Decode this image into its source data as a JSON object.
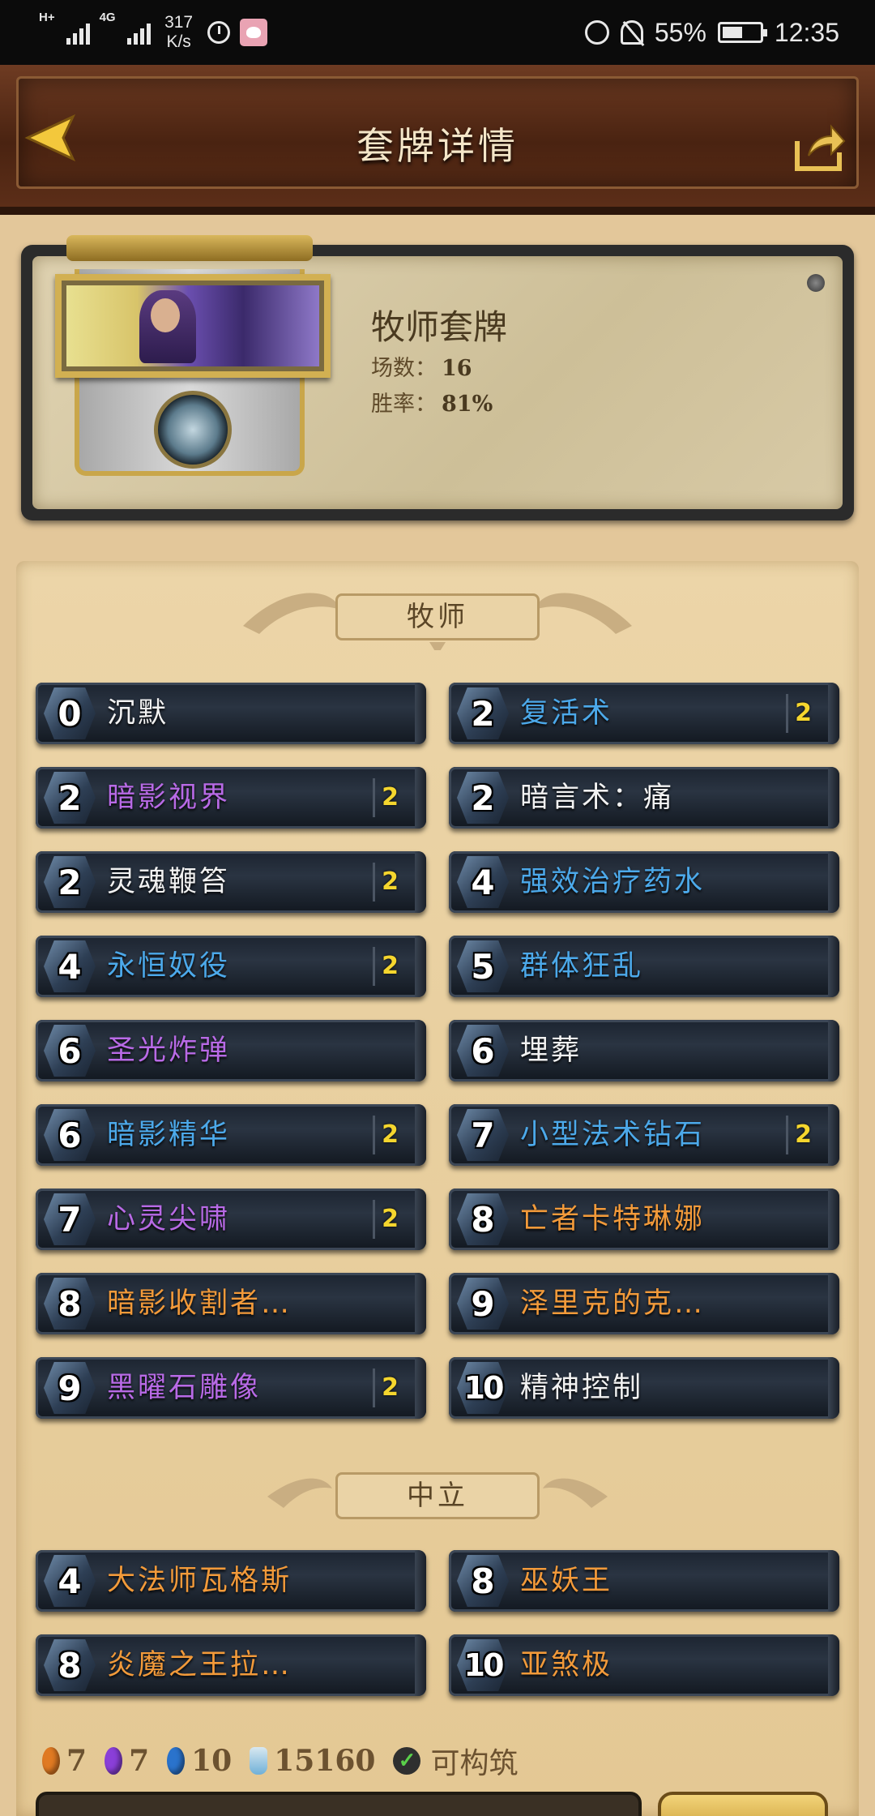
{
  "status_bar": {
    "network_type": "4G",
    "hd_label": "H+",
    "speed_value": "317",
    "speed_unit": "K/s",
    "battery": "55%",
    "time": "12:35"
  },
  "header": {
    "title": "套牌详情",
    "back_icon": "back-arrow-icon",
    "share_icon": "share-icon"
  },
  "deck": {
    "name": "牧师套牌",
    "games_label": "场数：",
    "games": "16",
    "winrate_label": "胜率：",
    "winrate": "81%"
  },
  "sections": {
    "class_label": "牧师",
    "neutral_label": "中立"
  },
  "class_cards": [
    {
      "cost": "0",
      "name": "沉默",
      "rarity": "common",
      "qty": ""
    },
    {
      "cost": "2",
      "name": "复活术",
      "rarity": "rare",
      "qty": "2"
    },
    {
      "cost": "2",
      "name": "暗影视界",
      "rarity": "epic",
      "qty": "2"
    },
    {
      "cost": "2",
      "name": "暗言术：痛",
      "rarity": "common",
      "qty": ""
    },
    {
      "cost": "2",
      "name": "灵魂鞭笞",
      "rarity": "common",
      "qty": "2"
    },
    {
      "cost": "4",
      "name": "强效治疗药水",
      "rarity": "rare",
      "qty": ""
    },
    {
      "cost": "4",
      "name": "永恒奴役",
      "rarity": "rare",
      "qty": "2"
    },
    {
      "cost": "5",
      "name": "群体狂乱",
      "rarity": "rare",
      "qty": ""
    },
    {
      "cost": "6",
      "name": "圣光炸弹",
      "rarity": "epic",
      "qty": ""
    },
    {
      "cost": "6",
      "name": "埋葬",
      "rarity": "common",
      "qty": ""
    },
    {
      "cost": "6",
      "name": "暗影精华",
      "rarity": "rare",
      "qty": "2"
    },
    {
      "cost": "7",
      "name": "小型法术钻石",
      "rarity": "rare",
      "qty": "2"
    },
    {
      "cost": "7",
      "name": "心灵尖啸",
      "rarity": "epic",
      "qty": "2"
    },
    {
      "cost": "8",
      "name": "亡者卡特琳娜",
      "rarity": "legendary",
      "qty": ""
    },
    {
      "cost": "8",
      "name": "暗影收割者…",
      "rarity": "legendary",
      "qty": ""
    },
    {
      "cost": "9",
      "name": "泽里克的克…",
      "rarity": "legendary",
      "qty": ""
    },
    {
      "cost": "9",
      "name": "黑曜石雕像",
      "rarity": "epic",
      "qty": "2"
    },
    {
      "cost": "10",
      "name": "精神控制",
      "rarity": "common",
      "qty": ""
    }
  ],
  "neutral_cards": [
    {
      "cost": "4",
      "name": "大法师瓦格斯",
      "rarity": "legendary",
      "qty": ""
    },
    {
      "cost": "8",
      "name": "巫妖王",
      "rarity": "legendary",
      "qty": ""
    },
    {
      "cost": "8",
      "name": "炎魔之王拉…",
      "rarity": "legendary",
      "qty": ""
    },
    {
      "cost": "10",
      "name": "亚煞极",
      "rarity": "legendary",
      "qty": ""
    }
  ],
  "rarity_colors": {
    "common": "#f2f2f2",
    "rare": "#4ca9ea",
    "epic": "#b86ae6",
    "legendary": "#f29a3a"
  },
  "footer": {
    "legendary_count": "7",
    "epic_count": "7",
    "rare_count": "10",
    "dust": "15160",
    "craftable_label": "可构筑"
  }
}
